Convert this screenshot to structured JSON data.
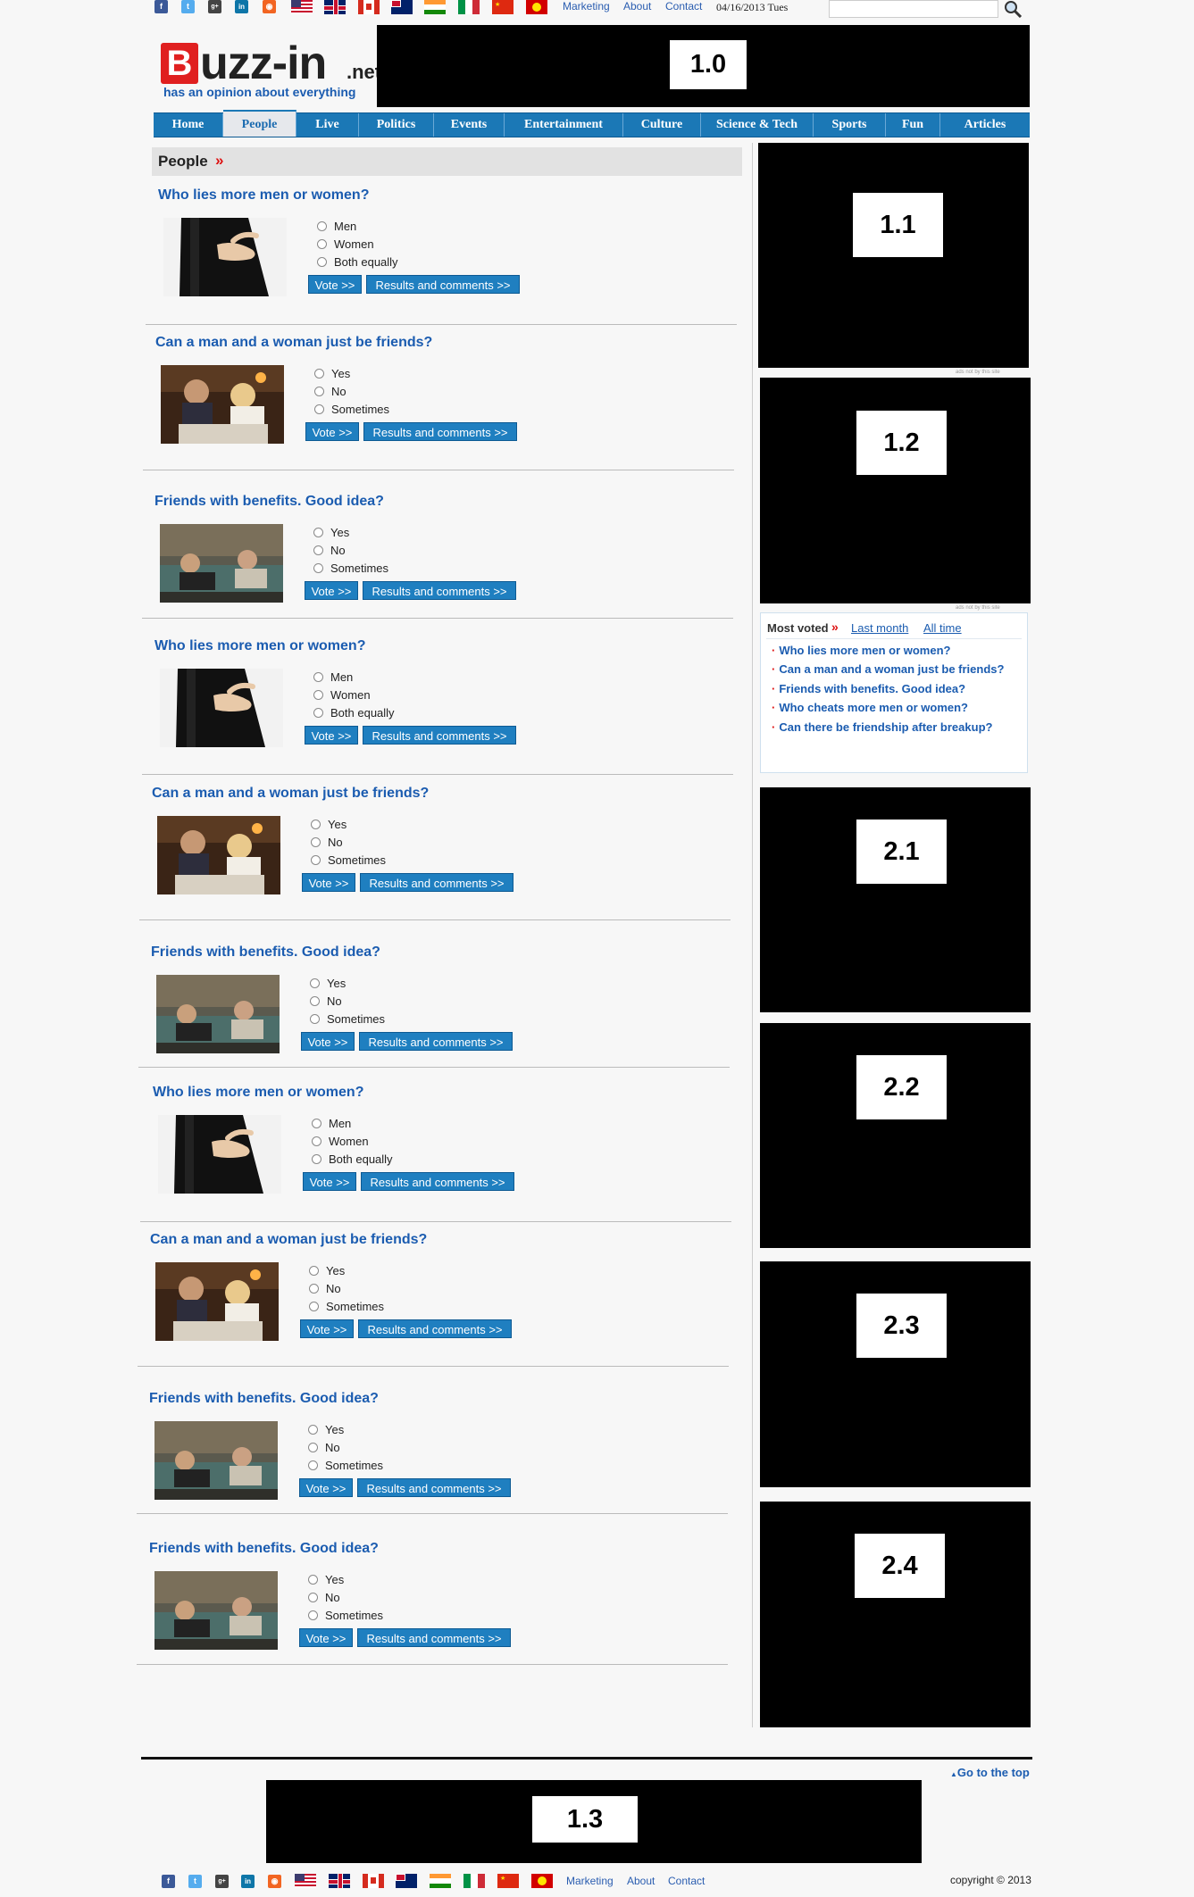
{
  "topbar": {
    "links": [
      "Marketing",
      "About",
      "Contact"
    ],
    "date": "04/16/2013 Tues",
    "search_placeholder": ""
  },
  "logo": {
    "name": "Buzz-in",
    "tld": ".net",
    "tagline": "has an opinion about everything",
    "brand_color": "#e02020"
  },
  "ads": {
    "top": "1.0",
    "side1": "1.1",
    "side2": "1.2",
    "side3": "2.1",
    "side4": "2.2",
    "side5": "2.3",
    "side6": "2.4",
    "bottom": "1.3",
    "note": "ads not by this site"
  },
  "nav": {
    "items": [
      "Home",
      "People",
      "Live",
      "Politics",
      "Events",
      "Entertainment",
      "Culture",
      "Science & Tech",
      "Sports",
      "Fun",
      "Articles"
    ],
    "active": "People",
    "color": "#1b78b6"
  },
  "section": {
    "title": "People",
    "arrow": "»"
  },
  "buttons": {
    "vote": "Vote >>",
    "results": "Results and comments >>"
  },
  "polls": [
    {
      "question": "Who lies more men or women?",
      "options": [
        "Men",
        "Women",
        "Both equally"
      ],
      "image": "crossed-fingers-image"
    },
    {
      "question": "Can a man and a woman just be friends?",
      "options": [
        "Yes",
        "No",
        "Sometimes"
      ],
      "image": "couple-dinner-image"
    },
    {
      "question": "Friends with benefits. Good idea?",
      "options": [
        "Yes",
        "No",
        "Sometimes"
      ],
      "image": "couple-sofa-image"
    },
    {
      "question": "Who lies more men or women?",
      "options": [
        "Men",
        "Women",
        "Both equally"
      ],
      "image": "crossed-fingers-image"
    },
    {
      "question": "Can a man and a woman just be friends?",
      "options": [
        "Yes",
        "No",
        "Sometimes"
      ],
      "image": "couple-dinner-image"
    },
    {
      "question": "Friends with benefits. Good idea?",
      "options": [
        "Yes",
        "No",
        "Sometimes"
      ],
      "image": "couple-sofa-image"
    },
    {
      "question": "Who lies more men or women?",
      "options": [
        "Men",
        "Women",
        "Both equally"
      ],
      "image": "crossed-fingers-image"
    },
    {
      "question": "Can a man and a woman just be friends?",
      "options": [
        "Yes",
        "No",
        "Sometimes"
      ],
      "image": "couple-dinner-image"
    },
    {
      "question": "Friends with benefits. Good idea?",
      "options": [
        "Yes",
        "No",
        "Sometimes"
      ],
      "image": "couple-sofa-image"
    },
    {
      "question": "Friends with benefits. Good idea?",
      "options": [
        "Yes",
        "No",
        "Sometimes"
      ],
      "image": "couple-sofa-image"
    }
  ],
  "most_voted": {
    "title": "Most voted",
    "arrow": "»",
    "tabs": [
      "Last month",
      "All time"
    ],
    "items": [
      "Who lies more men or women?",
      "Can a man and a woman just be friends?",
      "Friends with benefits. Good idea?",
      "Who cheats more men or women?",
      "Can there be friendship after breakup?"
    ]
  },
  "footer": {
    "go_top": "Go to the top",
    "links": [
      "Marketing",
      "About",
      "Contact"
    ],
    "copyright": "copyright © 2013"
  }
}
